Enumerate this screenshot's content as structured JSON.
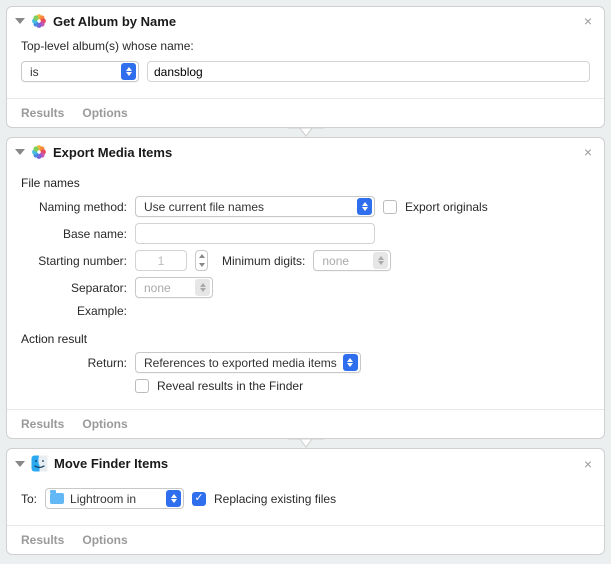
{
  "action1": {
    "title": "Get Album by Name",
    "prompt": "Top-level album(s) whose name:",
    "operator": "is",
    "value": "dansblog",
    "results_label": "Results",
    "options_label": "Options"
  },
  "action2": {
    "title": "Export Media Items",
    "filenames_heading": "File names",
    "naming_method_label": "Naming method:",
    "naming_method_value": "Use current file names",
    "export_originals_label": "Export originals",
    "export_originals_checked": false,
    "base_name_label": "Base name:",
    "base_name_value": "",
    "starting_number_label": "Starting number:",
    "starting_number_value": "1",
    "min_digits_label": "Minimum digits:",
    "min_digits_value": "none",
    "separator_label": "Separator:",
    "separator_value": "none",
    "example_label": "Example:",
    "example_value": "",
    "action_result_heading": "Action result",
    "return_label": "Return:",
    "return_value": "References to exported media items",
    "reveal_label": "Reveal results in the Finder",
    "reveal_checked": false,
    "results_label": "Results",
    "options_label": "Options"
  },
  "action3": {
    "title": "Move Finder Items",
    "to_label": "To:",
    "destination": "Lightroom in",
    "replace_label": "Replacing existing files",
    "replace_checked": true,
    "results_label": "Results",
    "options_label": "Options"
  }
}
